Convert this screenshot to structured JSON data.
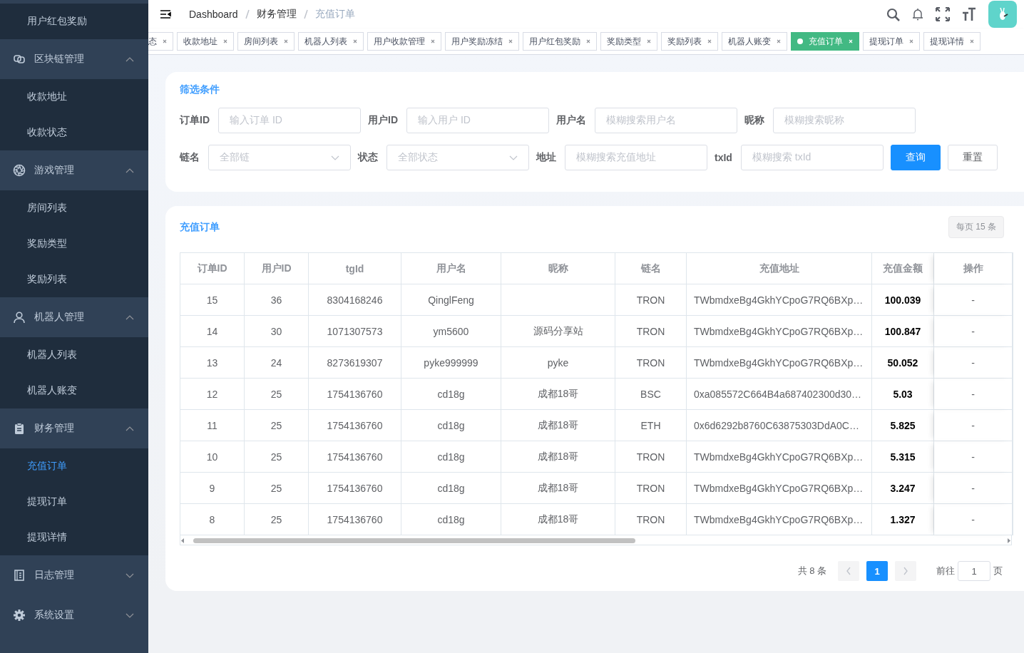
{
  "sidebar": {
    "items": [
      {
        "kind": "item",
        "label": "用户红包奖励",
        "selected": false
      },
      {
        "kind": "group",
        "label": "区块链管理",
        "expanded": true,
        "children": [
          {
            "label": "收款地址",
            "selected": false
          },
          {
            "label": "收款状态",
            "selected": false
          }
        ]
      },
      {
        "kind": "group",
        "label": "游戏管理",
        "expanded": true,
        "children": [
          {
            "label": "房间列表",
            "selected": false
          },
          {
            "label": "奖励类型",
            "selected": false
          },
          {
            "label": "奖励列表",
            "selected": false
          }
        ]
      },
      {
        "kind": "group",
        "label": "机器人管理",
        "expanded": true,
        "children": [
          {
            "label": "机器人列表",
            "selected": false
          },
          {
            "label": "机器人账变",
            "selected": false
          }
        ]
      },
      {
        "kind": "group",
        "label": "财务管理",
        "expanded": true,
        "children": [
          {
            "label": "充值订单",
            "selected": true
          },
          {
            "label": "提现订单",
            "selected": false
          },
          {
            "label": "提现详情",
            "selected": false
          }
        ]
      },
      {
        "kind": "group",
        "label": "日志管理",
        "expanded": false
      },
      {
        "kind": "group",
        "label": "系统设置",
        "expanded": false
      }
    ]
  },
  "breadcrumb": [
    "Dashboard",
    "财务管理",
    "充值订单"
  ],
  "tabs": [
    {
      "label": "态",
      "selected": false
    },
    {
      "label": "收款地址",
      "selected": false
    },
    {
      "label": "房间列表",
      "selected": false
    },
    {
      "label": "机器人列表",
      "selected": false
    },
    {
      "label": "用户收款管理",
      "selected": false
    },
    {
      "label": "用户奖励冻结",
      "selected": false
    },
    {
      "label": "用户红包奖励",
      "selected": false
    },
    {
      "label": "奖励类型",
      "selected": false
    },
    {
      "label": "奖励列表",
      "selected": false
    },
    {
      "label": "机器人账变",
      "selected": false
    },
    {
      "label": "充值订单",
      "selected": true
    },
    {
      "label": "提现订单",
      "selected": false
    },
    {
      "label": "提现详情",
      "selected": false
    }
  ],
  "filter": {
    "title": "筛选条件",
    "rows": [
      [
        {
          "kind": "input",
          "label": "订单ID",
          "placeholder": "输入订单 ID"
        },
        {
          "kind": "input",
          "label": "用户ID",
          "placeholder": "输入用户 ID"
        },
        {
          "kind": "input",
          "label": "用户名",
          "placeholder": "模糊搜索用户名"
        },
        {
          "kind": "input",
          "label": "昵称",
          "placeholder": "模糊搜索昵称"
        }
      ],
      [
        {
          "kind": "select",
          "label": "链名",
          "placeholder": "全部链"
        },
        {
          "kind": "select",
          "label": "状态",
          "placeholder": "全部状态"
        },
        {
          "kind": "input",
          "label": "地址",
          "placeholder": "模糊搜索充值地址"
        },
        {
          "kind": "input",
          "label": "txId",
          "placeholder": "模糊搜索 txId"
        }
      ]
    ],
    "buttons": [
      {
        "kind": "primary",
        "label": "查询"
      },
      {
        "kind": "default",
        "label": "重置"
      }
    ]
  },
  "orders": {
    "title": "充值订单",
    "page_size": "每页 15 条",
    "columns": [
      {
        "label": "订单ID",
        "kind": "text"
      },
      {
        "label": "用户ID",
        "kind": "text"
      },
      {
        "label": "tgId",
        "kind": "text"
      },
      {
        "label": "用户名",
        "kind": "text"
      },
      {
        "label": "昵称",
        "kind": "text"
      },
      {
        "label": "链名",
        "kind": "text"
      },
      {
        "label": "充值地址",
        "kind": "address"
      },
      {
        "label": "充值金额",
        "kind": "amount"
      },
      {
        "label": "操作",
        "kind": "action"
      }
    ],
    "rows": [
      [
        "15",
        "36",
        "8304168246",
        "QinglFeng",
        "",
        "TRON",
        "TWbmdxeBg4GkhYCpoG7RQ6BXp…",
        "100.039",
        "-"
      ],
      [
        "14",
        "30",
        "1071307573",
        "ym5600",
        "源码分享站",
        "TRON",
        "TWbmdxeBg4GkhYCpoG7RQ6BXp…",
        "100.847",
        "-"
      ],
      [
        "13",
        "24",
        "8273619307",
        "pyke999999",
        "pyke",
        "TRON",
        "TWbmdxeBg4GkhYCpoG7RQ6BXp…",
        "50.052",
        "-"
      ],
      [
        "12",
        "25",
        "1754136760",
        "cd18g",
        "成都18哥",
        "BSC",
        "0xa085572C664B4a687402300d30…",
        "5.03",
        "-"
      ],
      [
        "11",
        "25",
        "1754136760",
        "cd18g",
        "成都18哥",
        "ETH",
        "0x6d6292b8760C63875303DdA0C…",
        "5.825",
        "-"
      ],
      [
        "10",
        "25",
        "1754136760",
        "cd18g",
        "成都18哥",
        "TRON",
        "TWbmdxeBg4GkhYCpoG7RQ6BXp…",
        "5.315",
        "-"
      ],
      [
        "9",
        "25",
        "1754136760",
        "cd18g",
        "成都18哥",
        "TRON",
        "TWbmdxeBg4GkhYCpoG7RQ6BXp…",
        "3.247",
        "-"
      ],
      [
        "8",
        "25",
        "1754136760",
        "cd18g",
        "成都18哥",
        "TRON",
        "TWbmdxeBg4GkhYCpoG7RQ6BXp…",
        "1.327",
        "-"
      ]
    ],
    "pagination": {
      "total": "共 8 条",
      "prev": {
        "disabled": true
      },
      "pages": [
        {
          "label": "1",
          "selected": true
        }
      ],
      "next": {
        "disabled": true
      },
      "goto_label": "前往",
      "goto_value": "1",
      "suffix": "页"
    }
  }
}
